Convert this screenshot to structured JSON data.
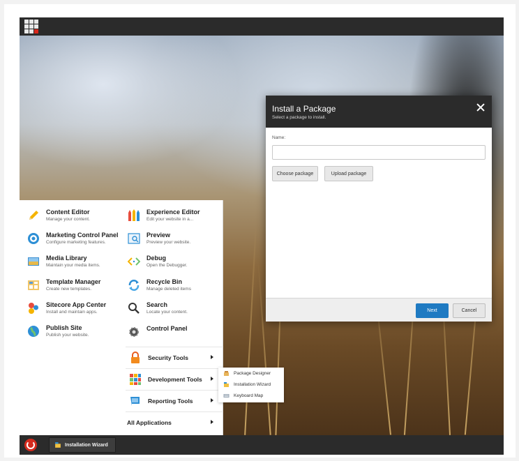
{
  "dialog": {
    "title": "Install a Package",
    "subtitle": "Select a package to install.",
    "name_label": "Name:",
    "name_value": "",
    "choose_button": "Choose package",
    "upload_button": "Upload package",
    "next_button": "Next",
    "cancel_button": "Cancel"
  },
  "start_menu": {
    "left_column": [
      {
        "title": "Content Editor",
        "desc": "Manage your content."
      },
      {
        "title": "Marketing Control Panel",
        "desc": "Configure marketing features."
      },
      {
        "title": "Media Library",
        "desc": "Maintain your media items."
      },
      {
        "title": "Template Manager",
        "desc": "Create new templates."
      },
      {
        "title": "Sitecore App Center",
        "desc": "Install and maintain apps."
      },
      {
        "title": "Publish Site",
        "desc": "Publish your website."
      }
    ],
    "right_column": [
      {
        "title": "Experience Editor",
        "desc": "Edit your website in a..."
      },
      {
        "title": "Preview",
        "desc": "Preview your website."
      },
      {
        "title": "Debug",
        "desc": "Open the Debugger."
      },
      {
        "title": "Recycle Bin",
        "desc": "Manage deleted items"
      },
      {
        "title": "Search",
        "desc": "Locate your content."
      },
      {
        "title": "Control Panel",
        "desc": ""
      }
    ],
    "tool_rows": [
      {
        "label": "Security Tools"
      },
      {
        "label": "Development Tools"
      },
      {
        "label": "Reporting Tools"
      }
    ],
    "all_apps": "All Applications"
  },
  "submenu": {
    "items": [
      {
        "label": "Package Designer"
      },
      {
        "label": "Installation Wizard"
      },
      {
        "label": "Keyboard Map"
      }
    ]
  },
  "taskbar": {
    "task_label": "Installation Wizard"
  },
  "colors": {
    "bar": "#2b2b2b",
    "primary_button": "#1f7ac2",
    "brand_red": "#d52b1e"
  }
}
